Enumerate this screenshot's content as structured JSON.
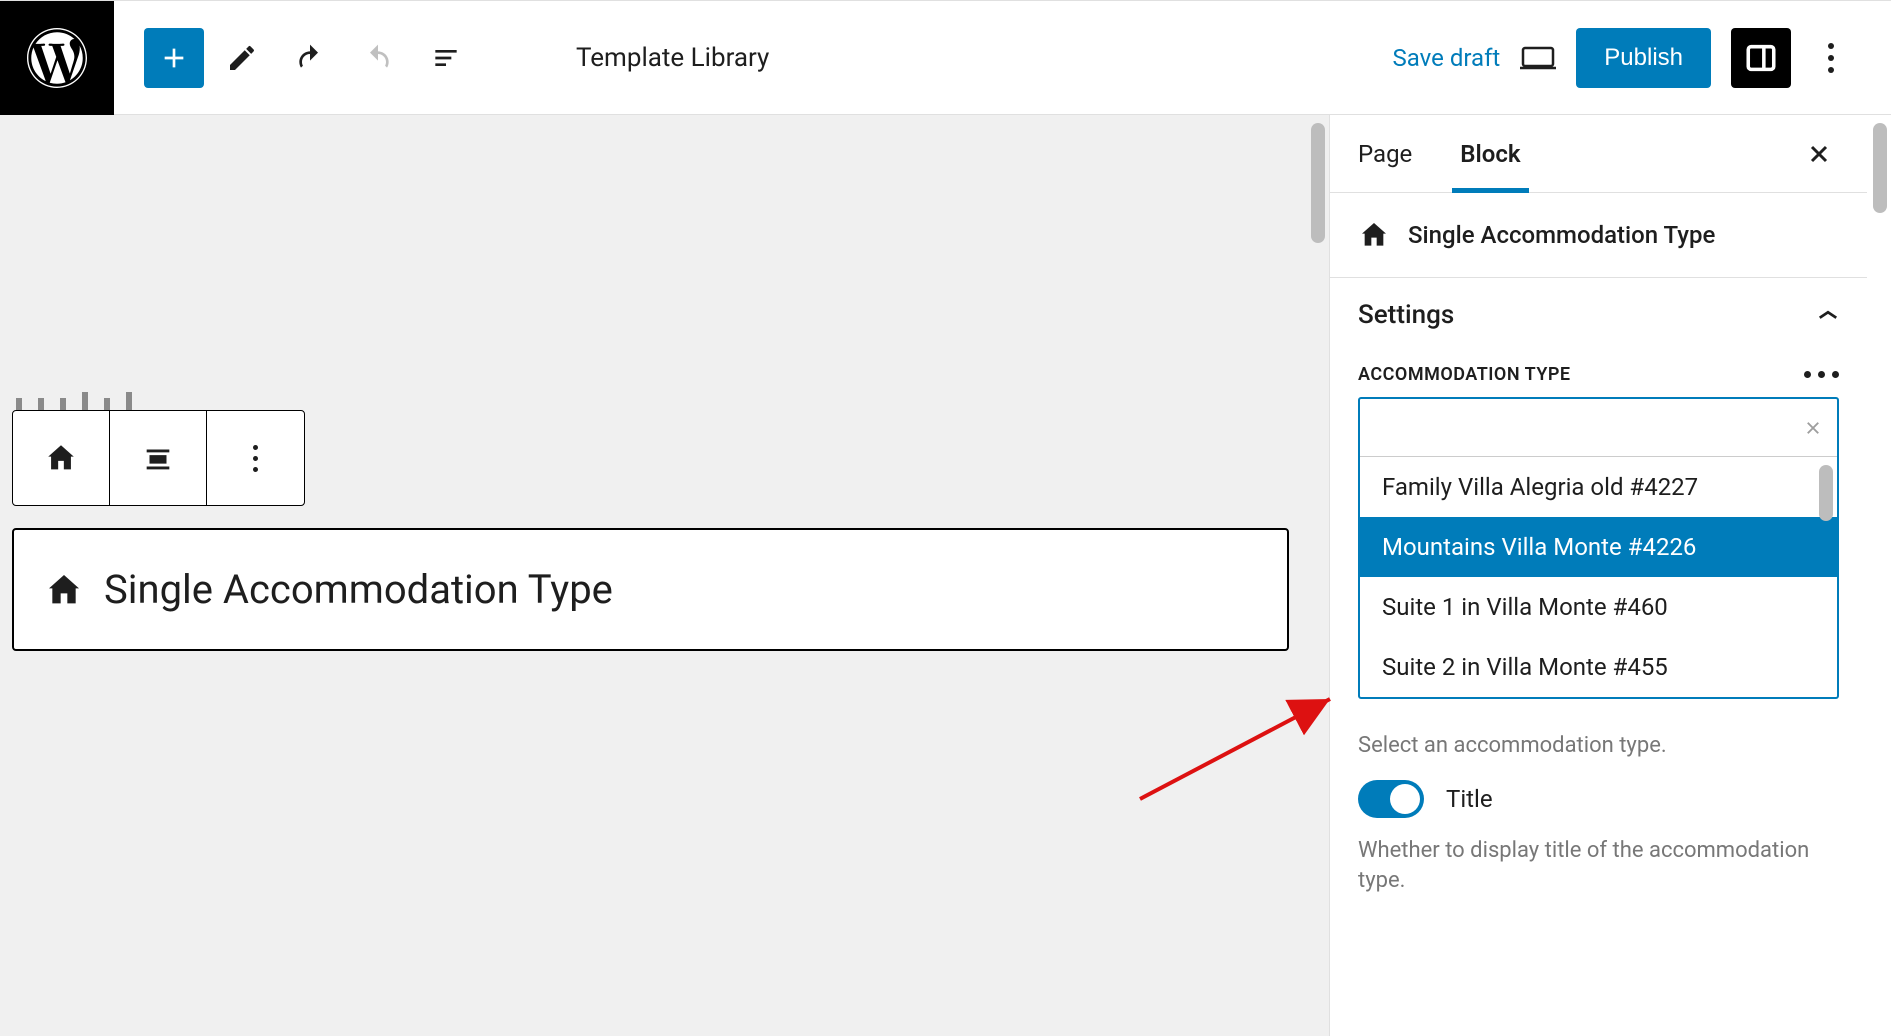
{
  "topbar": {
    "page_title": "Template Library",
    "save_draft": "Save draft",
    "publish": "Publish"
  },
  "canvas": {
    "block_title": "Single Accommodation Type"
  },
  "sidebar": {
    "tabs": {
      "page": "Page",
      "block": "Block"
    },
    "block_head": "Single Accommodation Type",
    "settings_label": "Settings",
    "field_label": "ACCOMMODATION TYPE",
    "options": [
      {
        "label": "Family Villa Alegria old #4227",
        "selected": false
      },
      {
        "label": "Mountains Villa Monte #4226",
        "selected": true
      },
      {
        "label": "Suite 1 in Villa Monte #460",
        "selected": false
      },
      {
        "label": "Suite 2 in Villa Monte #455",
        "selected": false
      }
    ],
    "help1": "Select an accommodation type.",
    "toggle_title_label": "Title",
    "help2": "Whether to display title of the accommodation type."
  }
}
